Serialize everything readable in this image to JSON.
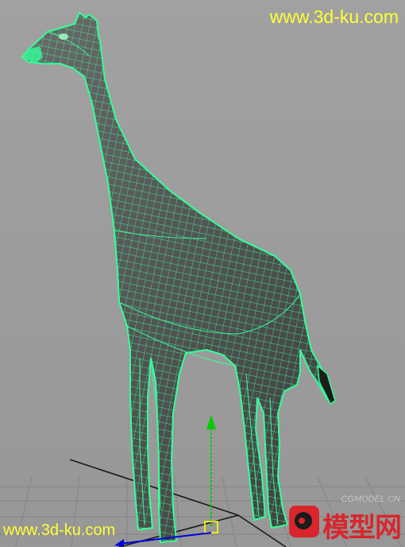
{
  "viewport": {
    "background_color": "#9c9c9c",
    "grid_color": "#808080",
    "wire_color": "#33ff99",
    "mesh_color": "#5c5c5c",
    "axis_y_color": "#00cc00",
    "axis_z_color": "#0000dd",
    "selected_model": "giraffe"
  },
  "watermarks": {
    "top": "www.3d-ku.com",
    "bottom": "www.3d-ku.com",
    "logo_text": "模型网",
    "logo_subtitle": "CGMODEL.CN"
  },
  "icons": {
    "manipulator": "move-manipulator-icon",
    "logo": "cgmodel-logo-icon"
  }
}
